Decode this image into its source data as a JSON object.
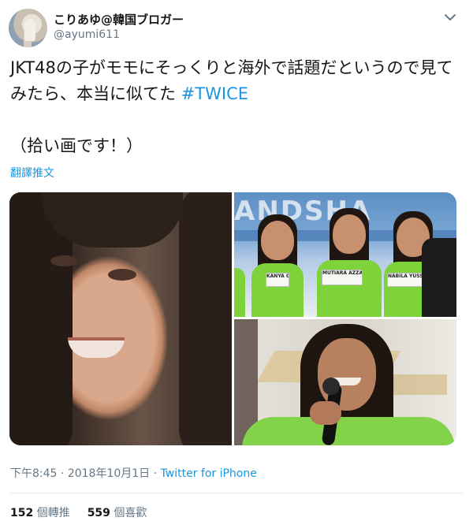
{
  "user": {
    "display_name": "こりあゆ@韓国ブロガー",
    "handle": "@ayumi611"
  },
  "tweet": {
    "text_main": "JKT48の子がモモにそっくりと海外で話題だというので見てみたら、本当に似てた ",
    "hashtag": "#TWICE",
    "text_note": "（拾い画です！）",
    "translate_label": "翻譯推文"
  },
  "media": {
    "banner_text": "ANDSHA",
    "name_tags": [
      "KANYA GAYA",
      "MUTIARA AZZAHRA U",
      "NABILA YUSSI FITRIA"
    ]
  },
  "meta": {
    "time": "下午8:45",
    "sep1": " · ",
    "date": "2018年10月1日",
    "sep2": " · ",
    "source": "Twitter for iPhone"
  },
  "stats": {
    "retweets_count": "152",
    "retweets_label": " 個轉推",
    "likes_count": "559",
    "likes_label": " 個喜歡"
  },
  "colors": {
    "link": "#1b95e0",
    "secondary_text": "#657786",
    "primary_text": "#14171a",
    "shirt_green": "#7ed23a"
  }
}
